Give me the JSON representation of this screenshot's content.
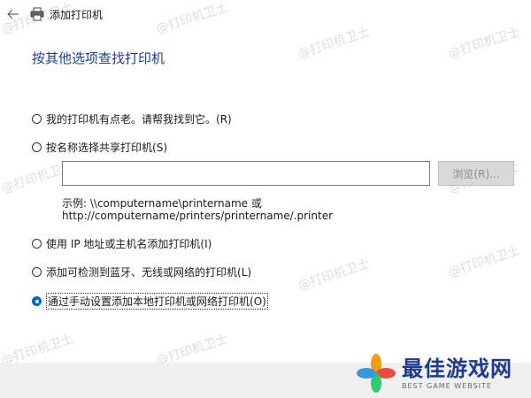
{
  "window": {
    "title": "添加打印机"
  },
  "heading": "按其他选项查找打印机",
  "options": [
    {
      "label": "我的打印机有点老。请帮我找到它。",
      "key": "(R)",
      "selected": false
    },
    {
      "label": "按名称选择共享打印机",
      "key": "(S)",
      "selected": false
    },
    {
      "label": "使用 IP 地址或主机名添加打印机",
      "key": "(I)",
      "selected": false
    },
    {
      "label": "添加可检测到蓝牙、无线或网络的打印机",
      "key": "(L)",
      "selected": false
    },
    {
      "label": "通过手动设置添加本地打印机或网络打印机",
      "key": "(O)",
      "selected": true
    }
  ],
  "share_name": {
    "value": "",
    "browse_label": "浏览(R)..."
  },
  "example": {
    "line1": "示例: \\\\computername\\printername 或",
    "line2": "http://computername/printers/printername/.printer"
  },
  "watermark_text": "@打印机卫士",
  "logo": {
    "main": "最佳游戏网",
    "sub": "BEST GAME WEBSITE"
  },
  "colors": {
    "heading": "#1c3f94",
    "accent": "#0067c0",
    "footer": "#f0f0f0"
  }
}
